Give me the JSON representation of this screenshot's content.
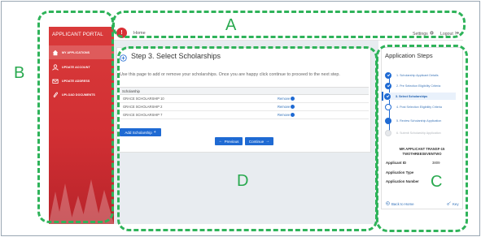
{
  "sidebar": {
    "title": "APPLICANT PORTAL",
    "items": [
      {
        "label": "MY APPLICATIONS",
        "icon": "home-icon"
      },
      {
        "label": "UPDATE ACCOUNT",
        "icon": "user-icon"
      },
      {
        "label": "UPDATE ADDRESS",
        "icon": "envelope-icon"
      },
      {
        "label": "UPLOAD DOCUMENTS",
        "icon": "paperclip-icon"
      }
    ]
  },
  "topbar": {
    "badge": "!",
    "home": "Home",
    "settings": "Settings",
    "logout": "Logout"
  },
  "main": {
    "title": "Step 3. Select Scholarships",
    "instruction": "Use this page to add or remove your scholarships. Once you are happy click continue to proceed to the next step.",
    "table_header": "Scholarship",
    "rows": [
      {
        "name": "GRACE SCHOLARSHIP 10",
        "action": "Remove"
      },
      {
        "name": "GRACE SCHOLARSHIP 2",
        "action": "Remove"
      },
      {
        "name": "GRACE SCHOLARSHIP 7",
        "action": "Remove"
      }
    ],
    "add_button": "Add Scholarship",
    "previous_button": "Previous",
    "continue_button": "Continue"
  },
  "steps_panel": {
    "title": "Application Steps",
    "steps": [
      {
        "label": "1. Scholarship Applicant Details",
        "state": "done"
      },
      {
        "label": "2. Pre Selection Eligibility Criteria",
        "state": "done"
      },
      {
        "label": "3. Select Scholarships",
        "state": "current"
      },
      {
        "label": "4. Post Selection Eligibility Criteria",
        "state": "pending"
      },
      {
        "label": "5. Review Scholarship Application",
        "state": "pending"
      },
      {
        "label": "6. Submit Scholarship Application",
        "state": "locked"
      }
    ],
    "applicant_line1": "MR APPLICANT TRANSF-15",
    "applicant_line2": "TWOTHREESEVENTWO",
    "fields": [
      {
        "key": "Applicant ID",
        "value": "3809"
      },
      {
        "key": "Application Type",
        "value": ""
      },
      {
        "key": "Application Number",
        "value": ""
      }
    ],
    "back_link": "Back to Home",
    "key_link": "Key"
  },
  "annotations": {
    "A": "A",
    "B": "B",
    "C": "C",
    "D": "D"
  },
  "colors": {
    "brand_red": "#d12f33",
    "accent_blue": "#1f6ad3",
    "annotation_green": "#2fb35a"
  }
}
